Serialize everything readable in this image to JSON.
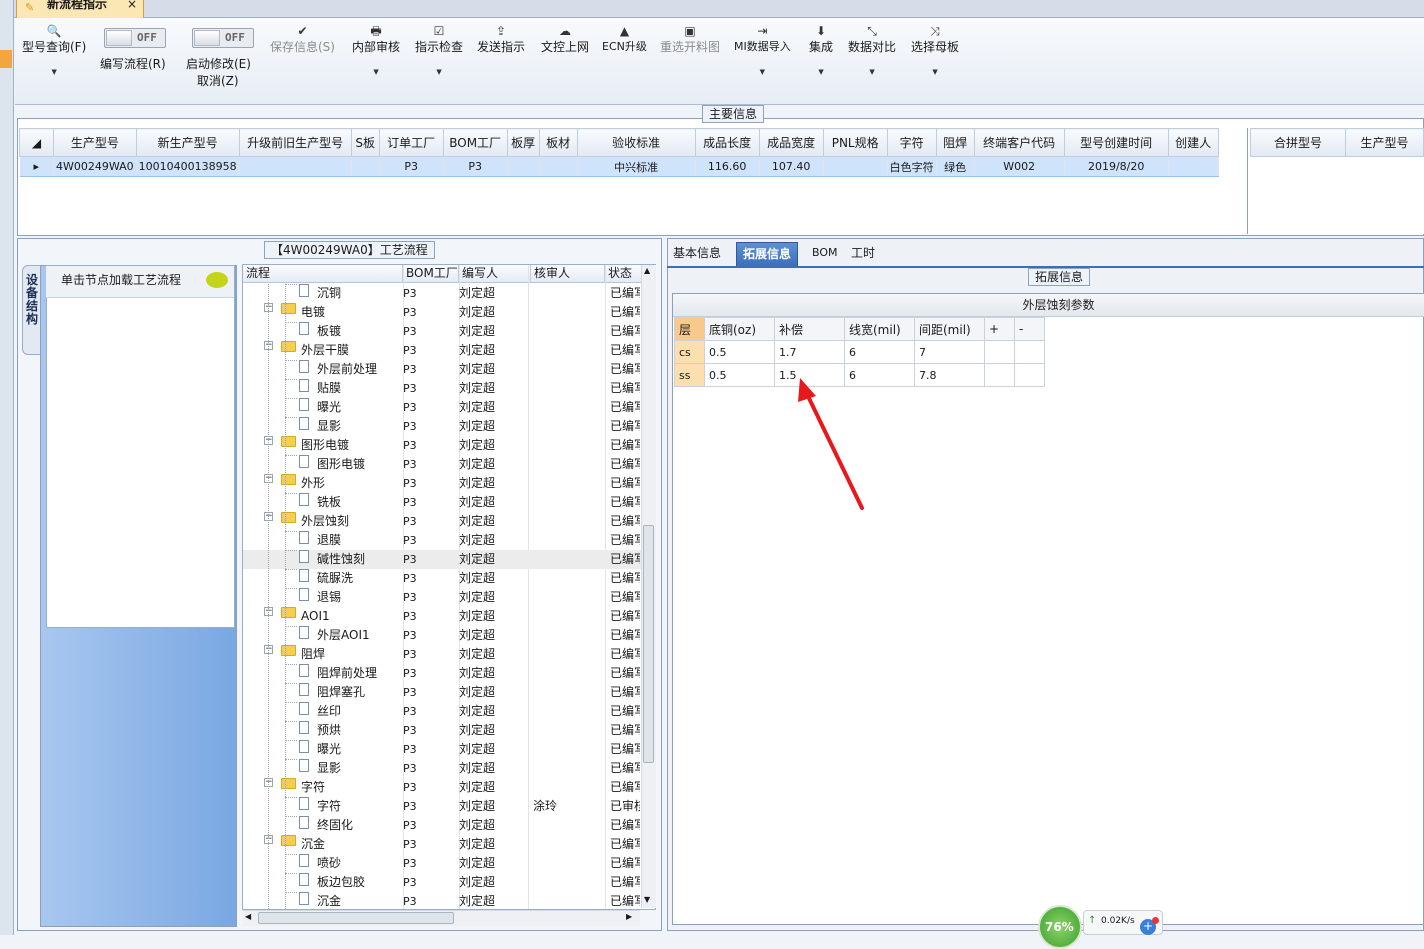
{
  "window": {
    "doc_tab": "新流程指示",
    "close_glyph": "×"
  },
  "toolbar": {
    "query": {
      "label": "型号查询(F)"
    },
    "edit_flow": {
      "label": "编写流程(R)",
      "toggle": "OFF"
    },
    "auto_modify": {
      "label": "启动修改(E)",
      "label2": "取消(Z)",
      "toggle": "OFF"
    },
    "save": {
      "label": "保存信息(S)"
    },
    "internal_review": {
      "label": "内部审核"
    },
    "instruction_check": {
      "label": "指示检查"
    },
    "send_instruction": {
      "label": "发送指示"
    },
    "doc_online": {
      "label": "文控上网"
    },
    "ecn_upgrade": {
      "label": "ECN升级"
    },
    "reselect_chart": {
      "label": "重选开料图"
    },
    "mi_import": {
      "label": "MI数据导入"
    },
    "integrate": {
      "label": "集成"
    },
    "data_compare": {
      "label": "数据对比"
    },
    "select_master": {
      "label": "选择母板"
    }
  },
  "main_info": {
    "title": "主要信息",
    "columns": [
      "生产型号",
      "新生产型号",
      "升级前旧生产型号",
      "S板",
      "订单工厂",
      "BOM工厂",
      "板厚",
      "板材",
      "验收标准",
      "成品长度",
      "成品宽度",
      "PNL规格",
      "字符",
      "阻焊",
      "终端客户代码",
      "型号创建时间",
      "创建人"
    ],
    "row": [
      "4W00249WA0",
      "10010400138958",
      "",
      "",
      "P3",
      "P3",
      "",
      "",
      "中兴标准",
      "116.60",
      "107.40",
      "",
      "白色字符",
      "绿色",
      "W002",
      "2019/8/20",
      ""
    ],
    "merge_columns": [
      "合拼型号",
      "生产型号"
    ]
  },
  "process": {
    "title": "【4W00249WA0】工艺流程",
    "side_tab": "设备结构",
    "node_hint": "单击节点加载工艺流程",
    "columns": [
      "流程",
      "BOM工厂",
      "编写人",
      "核审人",
      "状态"
    ],
    "rows": [
      {
        "name": "沉铜",
        "type": "file",
        "bom": "P3",
        "writer": "刘定超",
        "reviewer": "",
        "status": "已编写"
      },
      {
        "name": "电镀",
        "type": "folder",
        "bom": "P3",
        "writer": "刘定超",
        "reviewer": "",
        "status": "已编写"
      },
      {
        "name": "板镀",
        "type": "file",
        "bom": "P3",
        "writer": "刘定超",
        "reviewer": "",
        "status": "已编写"
      },
      {
        "name": "外层干膜",
        "type": "folder",
        "bom": "P3",
        "writer": "刘定超",
        "reviewer": "",
        "status": "已编写"
      },
      {
        "name": "外层前处理",
        "type": "file",
        "bom": "P3",
        "writer": "刘定超",
        "reviewer": "",
        "status": "已编写"
      },
      {
        "name": "贴膜",
        "type": "file",
        "bom": "P3",
        "writer": "刘定超",
        "reviewer": "",
        "status": "已编写"
      },
      {
        "name": "曝光",
        "type": "file",
        "bom": "P3",
        "writer": "刘定超",
        "reviewer": "",
        "status": "已编写"
      },
      {
        "name": "显影",
        "type": "file",
        "bom": "P3",
        "writer": "刘定超",
        "reviewer": "",
        "status": "已编写"
      },
      {
        "name": "图形电镀",
        "type": "folder",
        "bom": "P3",
        "writer": "刘定超",
        "reviewer": "",
        "status": "已编写"
      },
      {
        "name": "图形电镀",
        "type": "file",
        "bom": "P3",
        "writer": "刘定超",
        "reviewer": "",
        "status": "已编写"
      },
      {
        "name": "外形",
        "type": "folder",
        "bom": "P3",
        "writer": "刘定超",
        "reviewer": "",
        "status": "已编写"
      },
      {
        "name": "铣板",
        "type": "file",
        "bom": "P3",
        "writer": "刘定超",
        "reviewer": "",
        "status": "已编写"
      },
      {
        "name": "外层蚀刻",
        "type": "folder",
        "bom": "P3",
        "writer": "刘定超",
        "reviewer": "",
        "status": "已编写"
      },
      {
        "name": "退膜",
        "type": "file",
        "bom": "P3",
        "writer": "刘定超",
        "reviewer": "",
        "status": "已编写"
      },
      {
        "name": "碱性蚀刻",
        "type": "file",
        "bom": "P3",
        "writer": "刘定超",
        "reviewer": "",
        "status": "已编写",
        "selected": true
      },
      {
        "name": "硫脲洗",
        "type": "file",
        "bom": "P3",
        "writer": "刘定超",
        "reviewer": "",
        "status": "已编写"
      },
      {
        "name": "退锡",
        "type": "file",
        "bom": "P3",
        "writer": "刘定超",
        "reviewer": "",
        "status": "已编写"
      },
      {
        "name": "AOI1",
        "type": "folder",
        "bom": "P3",
        "writer": "刘定超",
        "reviewer": "",
        "status": "已编写"
      },
      {
        "name": "外层AOI1",
        "type": "file",
        "bom": "P3",
        "writer": "刘定超",
        "reviewer": "",
        "status": "已编写"
      },
      {
        "name": "阻焊",
        "type": "folder",
        "bom": "P3",
        "writer": "刘定超",
        "reviewer": "",
        "status": "已编写"
      },
      {
        "name": "阻焊前处理",
        "type": "file",
        "bom": "P3",
        "writer": "刘定超",
        "reviewer": "",
        "status": "已编写"
      },
      {
        "name": "阻焊塞孔",
        "type": "file",
        "bom": "P3",
        "writer": "刘定超",
        "reviewer": "",
        "status": "已编写"
      },
      {
        "name": "丝印",
        "type": "file",
        "bom": "P3",
        "writer": "刘定超",
        "reviewer": "",
        "status": "已编写"
      },
      {
        "name": "预烘",
        "type": "file",
        "bom": "P3",
        "writer": "刘定超",
        "reviewer": "",
        "status": "已编写"
      },
      {
        "name": "曝光",
        "type": "file",
        "bom": "P3",
        "writer": "刘定超",
        "reviewer": "",
        "status": "已编写"
      },
      {
        "name": "显影",
        "type": "file",
        "bom": "P3",
        "writer": "刘定超",
        "reviewer": "",
        "status": "已编写"
      },
      {
        "name": "字符",
        "type": "folder",
        "bom": "P3",
        "writer": "刘定超",
        "reviewer": "",
        "status": "已编写"
      },
      {
        "name": "字符",
        "type": "file",
        "bom": "P3",
        "writer": "刘定超",
        "reviewer": "涂玲",
        "status": "已审核"
      },
      {
        "name": "终固化",
        "type": "file",
        "bom": "P3",
        "writer": "刘定超",
        "reviewer": "",
        "status": "已编写"
      },
      {
        "name": "沉金",
        "type": "folder",
        "bom": "P3",
        "writer": "刘定超",
        "reviewer": "",
        "status": "已编写"
      },
      {
        "name": "喷砂",
        "type": "file",
        "bom": "P3",
        "writer": "刘定超",
        "reviewer": "",
        "status": "已编写"
      },
      {
        "name": "板边包胶",
        "type": "file",
        "bom": "P3",
        "writer": "刘定超",
        "reviewer": "",
        "status": "已编写"
      },
      {
        "name": "沉金",
        "type": "file",
        "bom": "P3",
        "writer": "刘定超",
        "reviewer": "",
        "status": "已编写"
      }
    ]
  },
  "right": {
    "tabs": [
      "基本信息",
      "拓展信息",
      "BOM",
      "工时"
    ],
    "active_tab": 1,
    "group_title": "拓展信息",
    "section_title": "外层蚀刻参数",
    "etch_columns": [
      "层",
      "底铜(oz)",
      "补偿",
      "线宽(mil)",
      "间距(mil)",
      "+",
      "-"
    ],
    "etch_rows": [
      [
        "cs",
        "0.5",
        "1.7",
        "6",
        "7",
        "",
        ""
      ],
      [
        "ss",
        "0.5",
        "1.5",
        "6",
        "7.8",
        "",
        ""
      ]
    ],
    "annotation_color": "#e8191c"
  },
  "status": {
    "cpu": "76%",
    "net_speed": "0.02K/s",
    "accent": "#3aa12b"
  }
}
